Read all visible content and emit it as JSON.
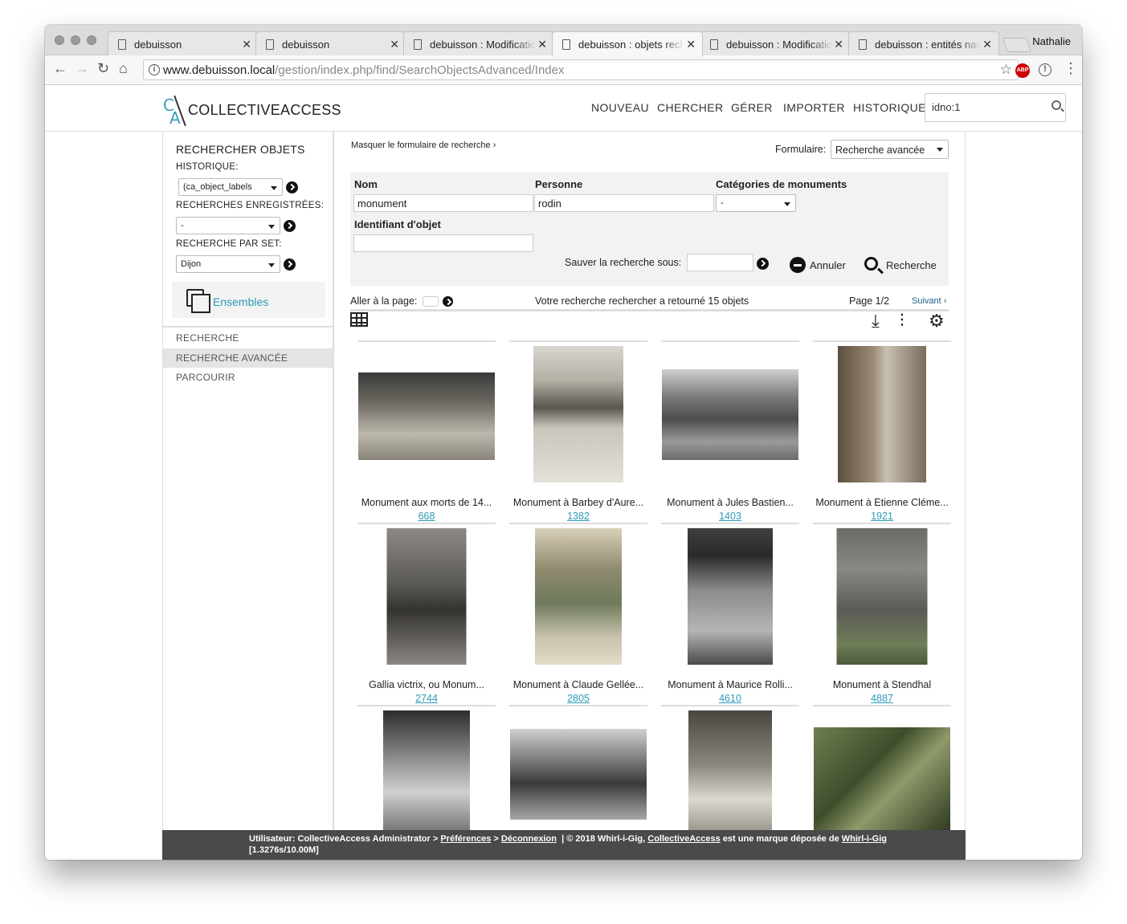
{
  "browser": {
    "tabs": [
      {
        "label": "debuisson"
      },
      {
        "label": "debuisson"
      },
      {
        "label": "debuisson : Modificatio"
      },
      {
        "label": "debuisson : objets rech"
      },
      {
        "label": "debuisson : Modificatio"
      },
      {
        "label": "debuisson : entités nav"
      }
    ],
    "user": "Nathalie",
    "url_host": "www.debuisson.local",
    "url_path": "/gestion/index.php/find/SearchObjectsAdvanced/Index",
    "extension_label": "ABP"
  },
  "header": {
    "logo_mark_top": "C",
    "logo_mark_bottom": "A",
    "logo_text": "COLLECTIVEACCESS",
    "nav": [
      "NOUVEAU",
      "CHERCHER",
      "GÉRER",
      "IMPORTER",
      "HISTORIQUE"
    ],
    "quick_search_value": "idno:1"
  },
  "sidebar": {
    "title": "RECHERCHER OBJETS",
    "history_label": "HISTORIQUE:",
    "history_value": "(ca_object_labels",
    "saved_label": "RECHERCHES ENREGISTRÉES:",
    "saved_value": "-",
    "set_label": "RECHERCHE PAR SET:",
    "set_value": "Dijon",
    "sets_link": "Ensembles",
    "nav": [
      "RECHERCHE",
      "RECHERCHE AVANCÉE",
      "PARCOURIR"
    ]
  },
  "form": {
    "hide_link": "Masquer le formulaire de recherche ›",
    "form_label": "Formulaire:",
    "form_value": "Recherche avancée",
    "nom_label": "Nom",
    "nom_value": "monument",
    "personne_label": "Personne",
    "personne_value": "rodin",
    "categories_label": "Catégories de monuments",
    "categories_value": "-",
    "identifiant_label": "Identifiant d'objet",
    "save_label": "Sauver la recherche sous:",
    "cancel_label": "Annuler",
    "search_label": "Recherche"
  },
  "results": {
    "goto_label": "Aller à la page:",
    "summary": "Votre recherche rechercher a retourné 15 objets",
    "page": "Page 1/2",
    "next": "Suivant ›",
    "items": [
      {
        "title": "Monument aux morts de 14...",
        "idno": "668"
      },
      {
        "title": "Monument à Barbey d'Aure...",
        "idno": "1382"
      },
      {
        "title": "Monument à Jules Bastien...",
        "idno": "1403"
      },
      {
        "title": "Monument à Etienne Cléme...",
        "idno": "1921"
      },
      {
        "title": "Gallia victrix, ou Monum...",
        "idno": "2744"
      },
      {
        "title": "Monument à Claude Gellée...",
        "idno": "2805"
      },
      {
        "title": "Monument à Maurice Rolli...",
        "idno": "4610"
      },
      {
        "title": "Monument à Stendhal",
        "idno": "4887"
      }
    ]
  },
  "footer": {
    "user_text": "Utilisateur: CollectiveAccess Administrator >",
    "prefs": "Préférences",
    "sep": ">",
    "logout": "Déconnexion",
    "copyright": "|  © 2018 Whirl-i-Gig,",
    "ca_link": "CollectiveAccess",
    "trademark": "est une marque déposée de",
    "wig_link": "Whirl-i-Gig",
    "timing": "[1.3276s/10.00M]"
  }
}
